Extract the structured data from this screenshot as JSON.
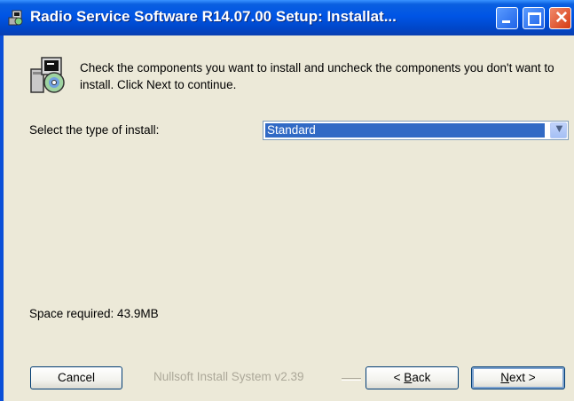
{
  "window": {
    "title": "Radio Service Software R14.07.00 Setup: Installat...",
    "controls": [
      "minimize",
      "maximize",
      "close"
    ],
    "title_icon": "installer-box-icon"
  },
  "header": {
    "icon": "installer-cd-icon",
    "instructions": "Check the components you want to install and uncheck the components you don't want to install. Click Next to continue."
  },
  "install_type": {
    "label": "Select the type of install:",
    "selected": "Standard"
  },
  "space_required": "Space required: 43.9MB",
  "footer": {
    "branding": "Nullsoft Install System v2.39",
    "cancel_label": "Cancel",
    "back_prefix": "< ",
    "back_mnemonic": "B",
    "back_rest": "ack",
    "next_mnemonic": "N",
    "next_rest": "ext >"
  },
  "colors": {
    "titlebar": "#0055E5",
    "dialog_bg": "#ECE9D8",
    "selection": "#316AC5",
    "disabled_text": "#ACA899"
  }
}
